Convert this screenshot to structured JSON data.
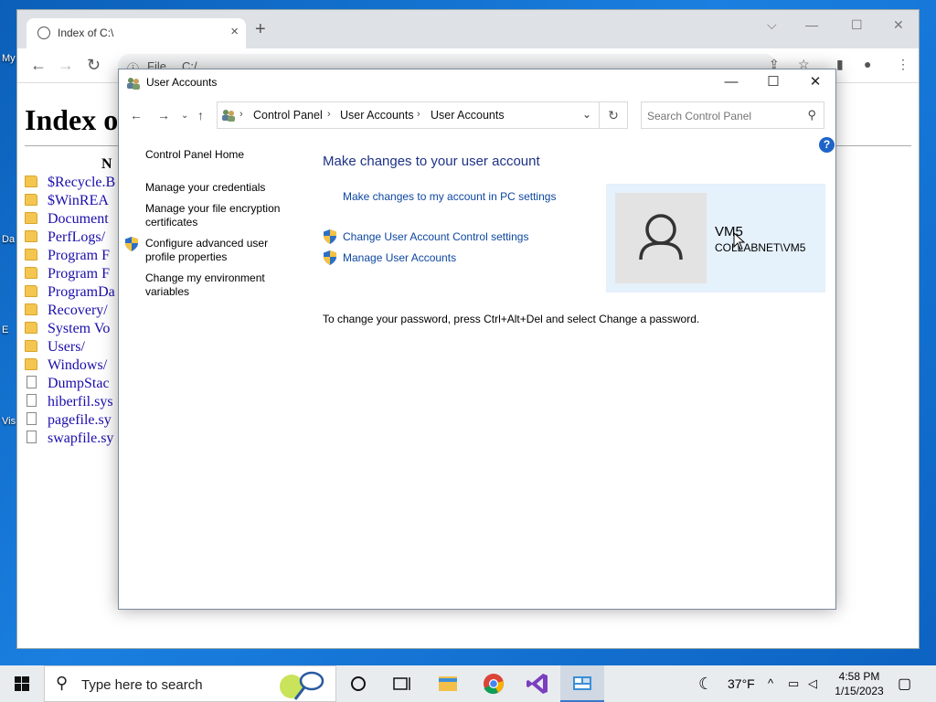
{
  "desktop": {
    "labels": [
      "My",
      "Da",
      "E",
      "Vis"
    ]
  },
  "browser": {
    "tab_title": "Index of C:\\",
    "address": {
      "scheme_label": "File",
      "path": "C:/"
    },
    "listing": {
      "heading": "Index o",
      "column_header": "N",
      "entries": [
        {
          "name": "$Recycle.B",
          "type": "folder"
        },
        {
          "name": "$WinREA",
          "type": "folder"
        },
        {
          "name": "Document",
          "type": "folder"
        },
        {
          "name": "PerfLogs/",
          "type": "folder"
        },
        {
          "name": "Program F",
          "type": "folder"
        },
        {
          "name": "Program F",
          "type": "folder"
        },
        {
          "name": "ProgramDa",
          "type": "folder"
        },
        {
          "name": "Recovery/",
          "type": "folder"
        },
        {
          "name": "System Vo",
          "type": "folder"
        },
        {
          "name": "Users/",
          "type": "folder"
        },
        {
          "name": "Windows/",
          "type": "folder"
        },
        {
          "name": "DumpStac",
          "type": "file"
        },
        {
          "name": "hiberfil.sys",
          "type": "file"
        },
        {
          "name": "pagefile.sy",
          "type": "file"
        },
        {
          "name": "swapfile.sy",
          "type": "file"
        }
      ]
    }
  },
  "control_panel": {
    "window_title": "User Accounts",
    "breadcrumb": [
      "Control Panel",
      "User Accounts",
      "User Accounts"
    ],
    "search_placeholder": "Search Control Panel",
    "help_label": "?",
    "left_nav": {
      "home": "Control Panel Home",
      "credentials": "Manage your credentials",
      "encryption": "Manage your file encryption certificates",
      "advanced_profile": "Configure advanced user profile properties",
      "environment": "Change my environment variables"
    },
    "main": {
      "heading": "Make changes to your user account",
      "pc_settings_link": "Make changes to my account in PC settings",
      "uac_link": "Change User Account Control settings",
      "manage_link": "Manage User Accounts",
      "password_note": "To change your password, press Ctrl+Alt+Del and select Change a password."
    },
    "user": {
      "name": "VM5",
      "domain": "COLLABNET\\VM5"
    }
  },
  "taskbar": {
    "search_placeholder": "Type here to search",
    "weather": "37°F",
    "time": "4:58 PM",
    "date": "1/15/2023"
  }
}
